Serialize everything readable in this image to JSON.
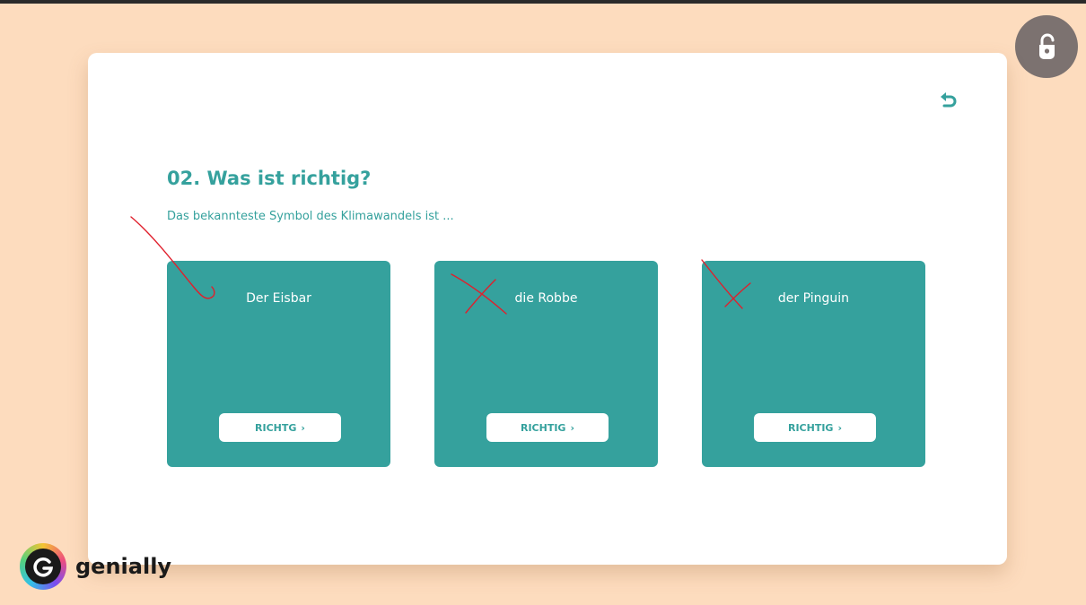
{
  "brand": {
    "name": "genially",
    "icon": "genially-logo"
  },
  "controls": {
    "lock_icon": "unlock-touch-icon",
    "back_icon": "undo-arrow-icon"
  },
  "question": {
    "title": "02. Was ist richtig?",
    "subtitle": "Das bekannteste Symbol des Klimawandels ist ..."
  },
  "options": [
    {
      "label": "Der Eisbar",
      "button": "RICHTG"
    },
    {
      "label": "die Robbe",
      "button": "RICHTIG"
    },
    {
      "label": "der Pinguin",
      "button": "RICHTIG"
    }
  ],
  "colors": {
    "accent": "#35a19d",
    "background": "#fddcbe",
    "annotation": "#e01f2c"
  }
}
